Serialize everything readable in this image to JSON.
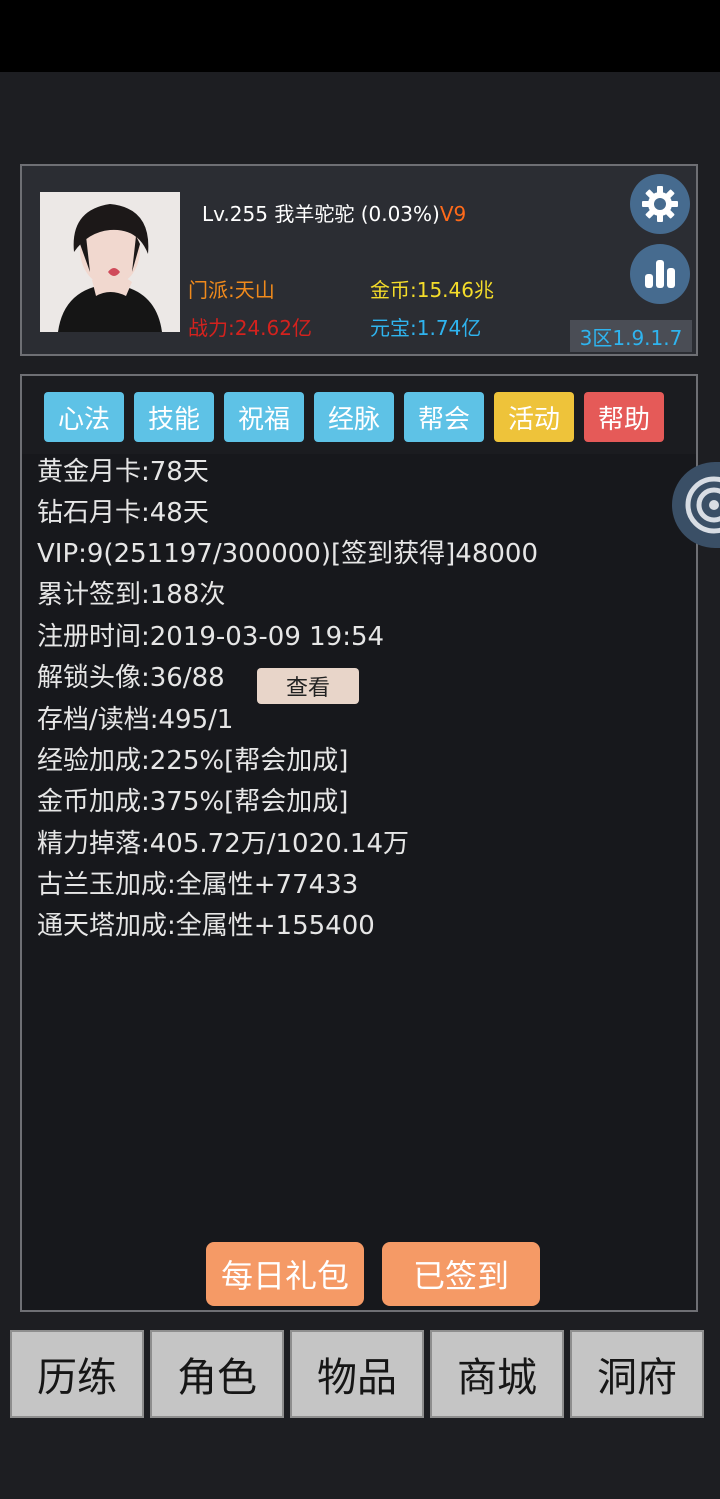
{
  "player": {
    "level": "Lv.255",
    "name": "我羊驼驼",
    "exp_percent": "(0.03%)",
    "vip": "V9",
    "sect": "门派:天山",
    "power": "战力:24.62亿",
    "gold": "金币:15.46兆",
    "yuanbao": "元宝:1.74亿",
    "server": "3区1.9.1.7"
  },
  "tabs": [
    {
      "label": "心法",
      "color": "#5ec2e6"
    },
    {
      "label": "技能",
      "color": "#5ec2e6"
    },
    {
      "label": "祝福",
      "color": "#5ec2e6"
    },
    {
      "label": "经脉",
      "color": "#5ec2e6"
    },
    {
      "label": "帮会",
      "color": "#5ec2e6"
    },
    {
      "label": "活动",
      "color": "#eec33a"
    },
    {
      "label": "帮助",
      "color": "#e55a58"
    }
  ],
  "info": [
    "黄金月卡:78天",
    "钻石月卡:48天",
    "VIP:9(251197/300000)[签到获得]48000",
    "累计签到:188次",
    "注册时间:2019-03-09 19:54",
    "解锁头像:36/88",
    "存档/读档:495/1",
    "经验加成:225%[帮会加成]",
    "金币加成:375%[帮会加成]",
    "精力掉落:405.72万/1020.14万",
    "古兰玉加成:全属性+77433",
    "通天塔加成:全属性+155400"
  ],
  "view_button": "查看",
  "actions": {
    "daily_gift": "每日礼包",
    "signed_in": "已签到"
  },
  "nav": [
    "历练",
    "角色",
    "物品",
    "商城",
    "洞府"
  ]
}
